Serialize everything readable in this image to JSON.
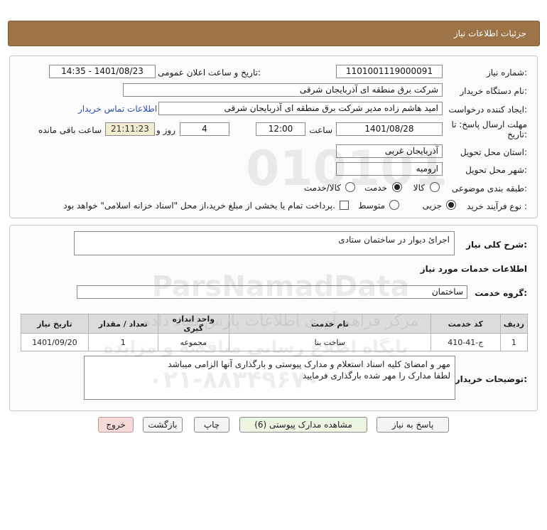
{
  "header": {
    "title": "جزئیات اطلاعات نیاز"
  },
  "form": {
    "need_number_label": "شماره نیاز:",
    "need_number": "1101001119000091",
    "announce_label": "تاریخ و ساعت اعلان عمومی:",
    "announce_value": "1401/08/23 - 14:35",
    "buyer_org_label": "نام دستگاه خریدار:",
    "buyer_org": "شرکت برق منطقه ای آذربایجان شرقی",
    "requester_label": "ایجاد کننده درخواست:",
    "requester": "امید هاشم زاده مدیر شرکت برق منطقه ای آذربایجان شرقی",
    "contact_link": "اطلاعات تماس خریدار",
    "deadline_label_1": "مهلت ارسال پاسخ: تا",
    "deadline_label_2": "تاریخ:",
    "deadline_date": "1401/08/28",
    "time_label": "ساعت",
    "deadline_time": "12:00",
    "days_value": "4",
    "days_label": "روز و",
    "remaining_time": "21:11:23",
    "remaining_label": "ساعت باقی مانده",
    "province_label": "استان محل تحویل:",
    "province": "آذربایجان غربی",
    "city_label": "شهر محل تحویل:",
    "city": "ارومیه",
    "category_label": "طبقه بندی موضوعی:",
    "category_options": [
      "کالا",
      "خدمت",
      "کالا/خدمت"
    ],
    "category_selected": "خدمت",
    "purchase_type_label": "نوع فرآیند خرید :",
    "purchase_options": [
      "جزیی",
      "متوسط"
    ],
    "purchase_selected": "جزیی",
    "treasury_note": "پرداخت تمام یا بخشی از مبلغ خرید،از محل \"اسناد خزانه اسلامی\" خواهد بود."
  },
  "details": {
    "summary_label": "شرح کلی نیاز:",
    "summary": "اجرائ دیوار در ساختمان ستادی",
    "services_heading": "اطلاعات خدمات مورد نیاز",
    "service_group_label": "گروه خدمت:",
    "service_group": "ساختمان",
    "table": {
      "headers": [
        "ردیف",
        "کد خدمت",
        "نام خدمت",
        "واحد اندازه گیری",
        "تعداد / مقدار",
        "تاریخ نیاز"
      ],
      "rows": [
        [
          "1",
          "ج-41-410",
          "ساخت بنا",
          "مجموعه",
          "1",
          "1401/09/20"
        ]
      ]
    },
    "buyer_notes_label": "توضیحات خریدار:",
    "buyer_notes_line1": "مهر و امضائ کلیه اسناد استعلام و مدارک پیوستی و بارگذاری آنها الزامی میباشد",
    "buyer_notes_line2": "لطفا مدارک را مهر شده بارگذاری فرمایید"
  },
  "buttons": {
    "reply": "پاسخ به نیاز",
    "attachments": "مشاهده مدارک پیوستی (6)",
    "print": "چاپ",
    "back": "بازگشت",
    "exit": "خروج"
  },
  "watermark": {
    "brand": "ParsNamadData",
    "line1": "مرکز فراهم آوری اطلاعات پارس نماد داده",
    "line2": "پایگاه اطلاع رسانی مناقصه و مزایده",
    "phone": "۰۲۱-۸۸۳۴۹۶۷۰",
    "digits": "010101"
  },
  "colors": {
    "header_bg": "#9c7447",
    "link": "#2a4fb0",
    "remaining_bg": "#f0ecd0",
    "exit_bg": "#f6d9d9"
  }
}
